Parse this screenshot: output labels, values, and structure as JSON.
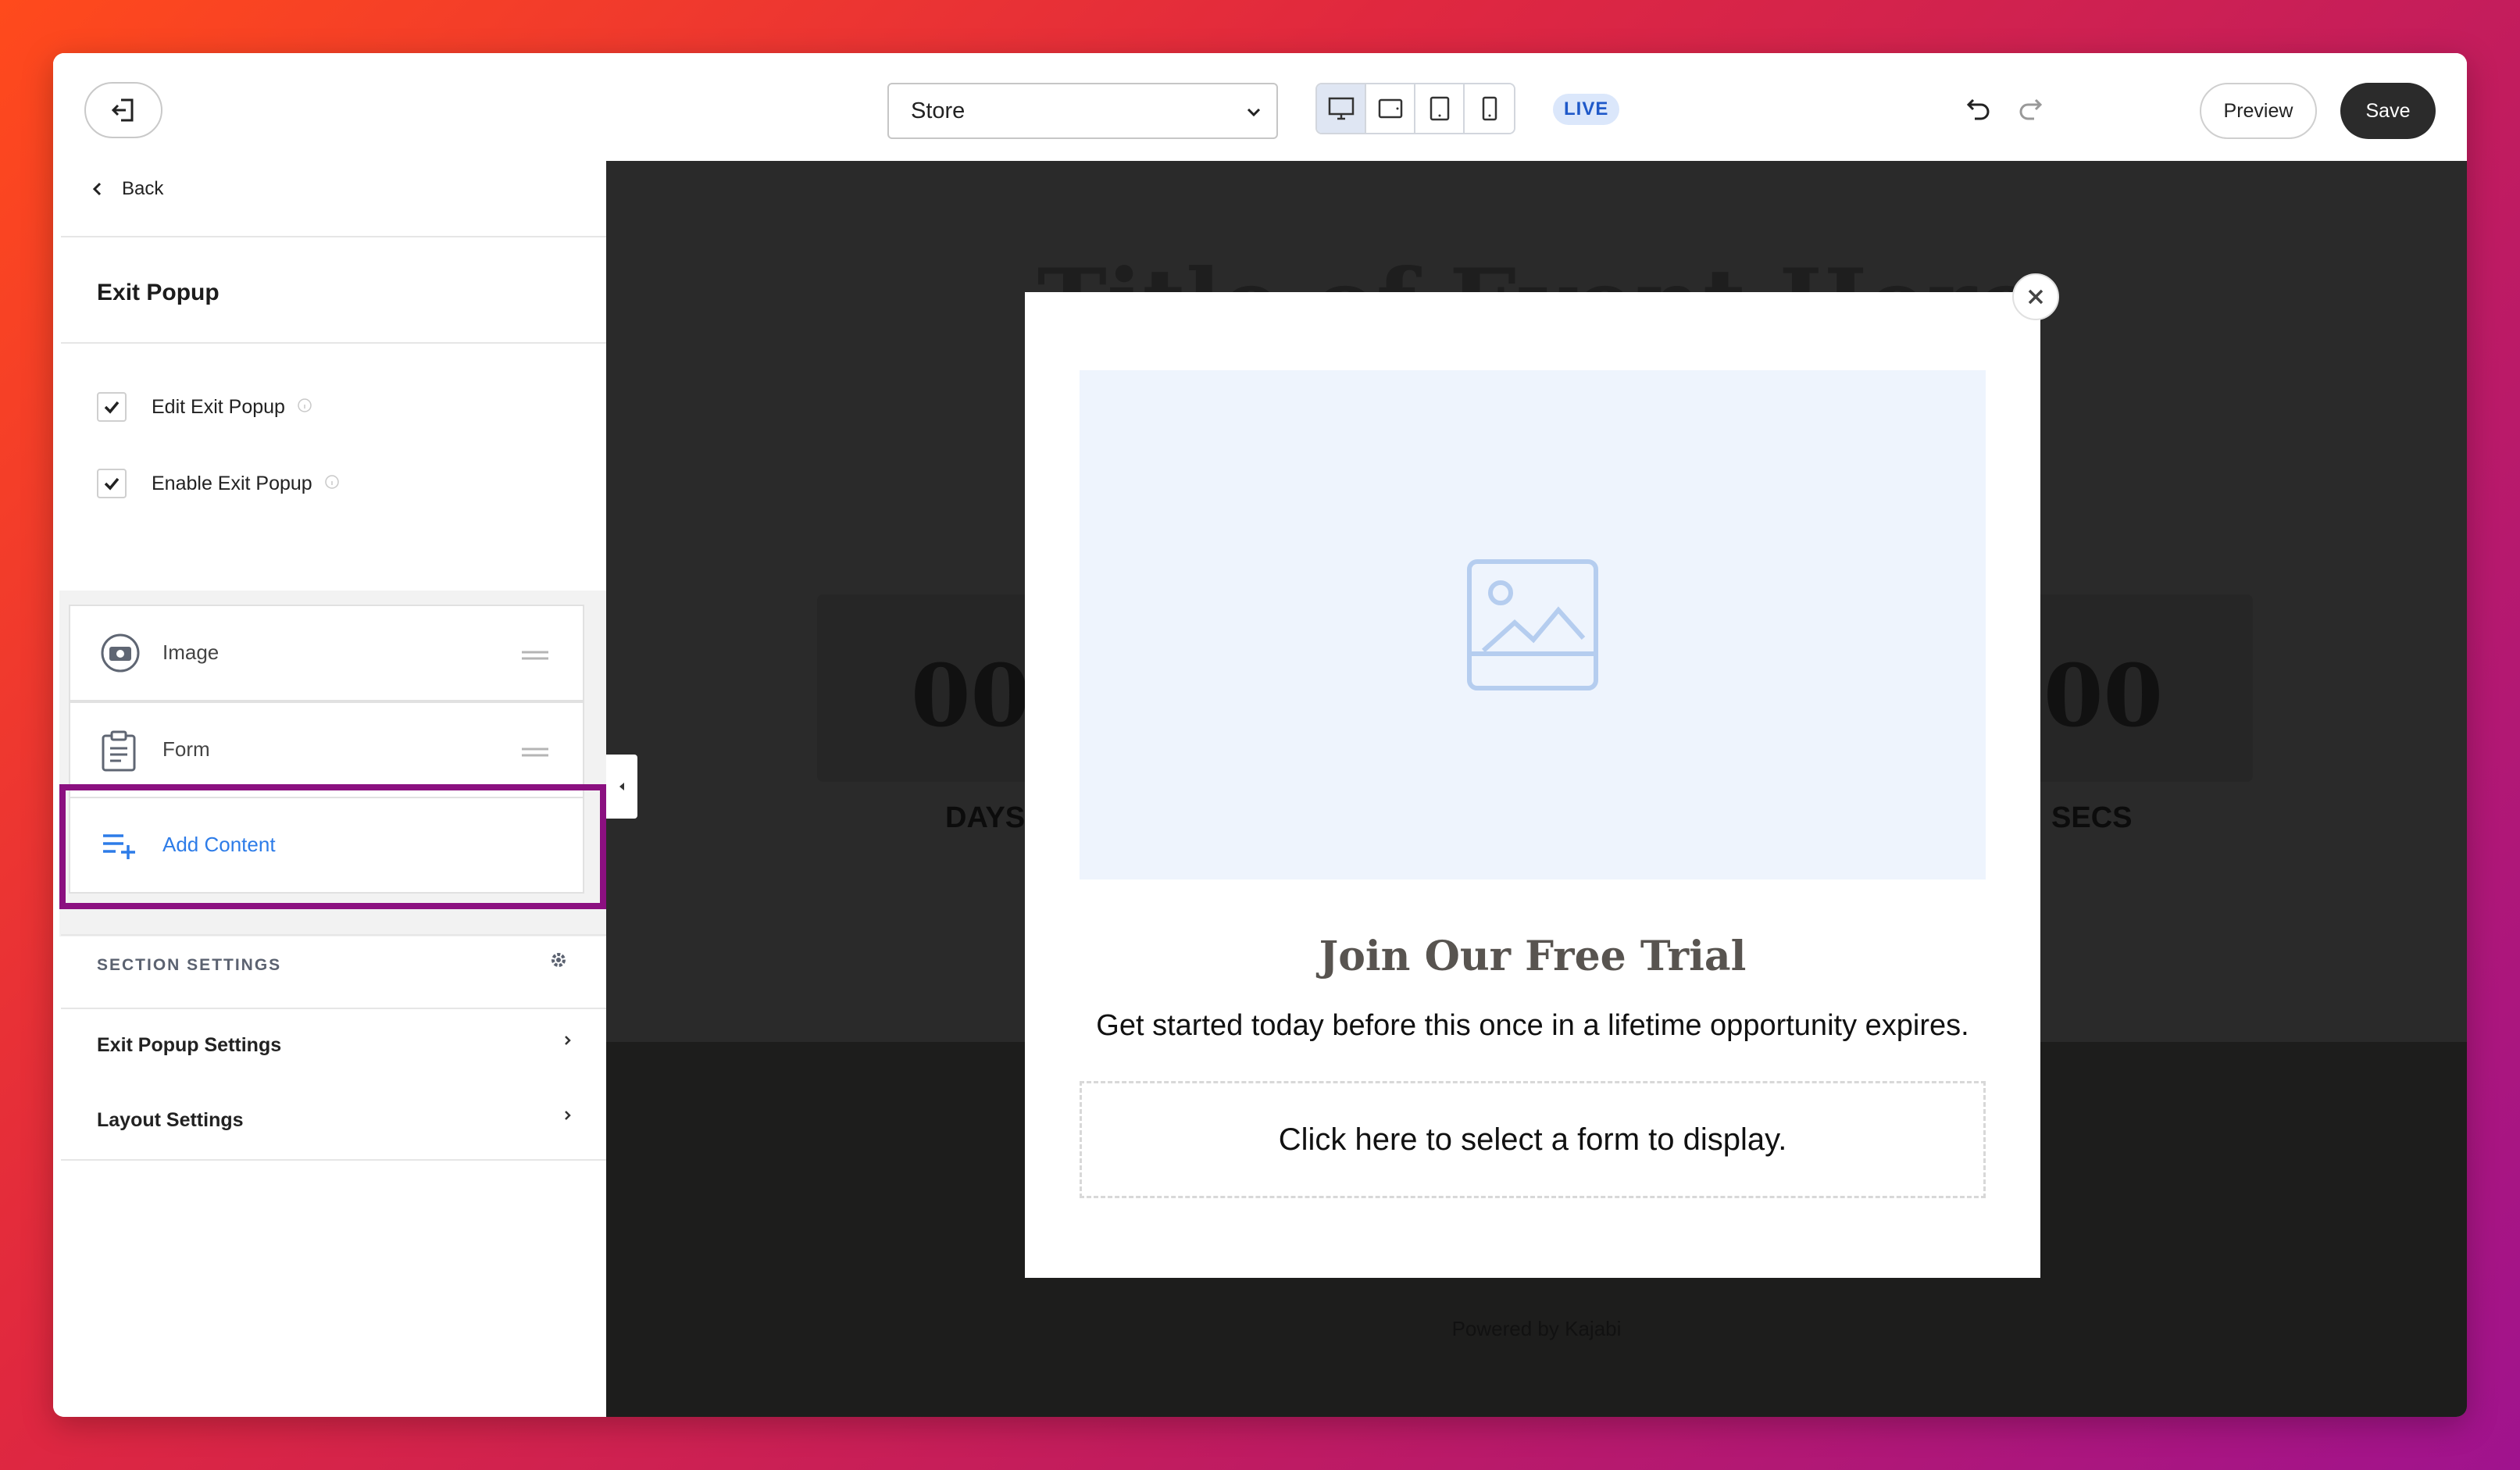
{
  "toolbar": {
    "store_select": "Store",
    "live_badge": "LIVE",
    "preview_label": "Preview",
    "save_label": "Save"
  },
  "sidebar": {
    "back_label": "Back",
    "panel_title": "Exit Popup",
    "checks": [
      {
        "label": "Edit Exit Popup",
        "checked": true
      },
      {
        "label": "Enable Exit Popup",
        "checked": true
      }
    ],
    "blocks": [
      {
        "label": "Image",
        "icon": "camera-icon"
      },
      {
        "label": "Form",
        "icon": "clipboard-icon"
      }
    ],
    "add_content_label": "Add Content",
    "section_settings_title": "SECTION SETTINGS",
    "settings": [
      {
        "label": "Exit Popup Settings"
      },
      {
        "label": "Layout Settings"
      }
    ]
  },
  "preview": {
    "background_title": "Title of Event Here",
    "digits_left": "00",
    "digits_right": "00",
    "label_days": "DAYS",
    "label_secs": "SECS",
    "powered_by": "Powered by Kajabi",
    "popup": {
      "title": "Join Our Free Trial",
      "subtitle": "Get started today before this once in a lifetime opportunity expires.",
      "form_placeholder": "Click here to select a form to display."
    }
  },
  "colors": {
    "accent_blue": "#2d7ce8",
    "highlight_purple": "#8b1080",
    "save_button": "#2b2b2b",
    "live_badge_bg": "#dbe7fb"
  }
}
